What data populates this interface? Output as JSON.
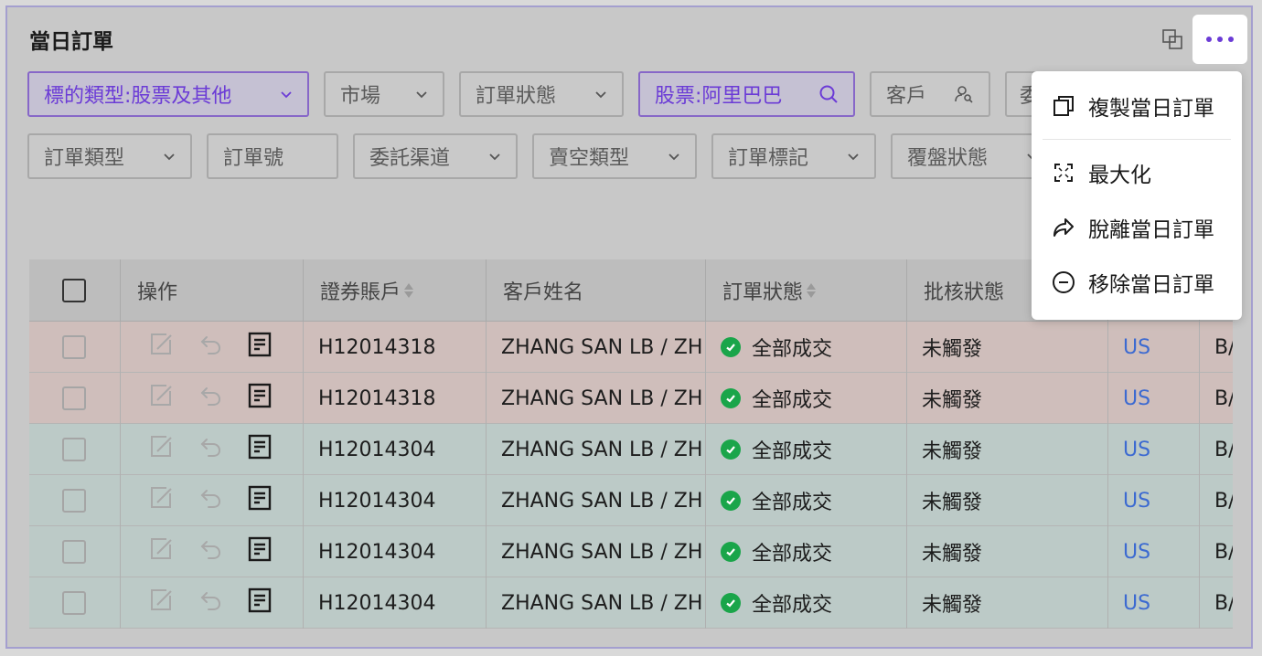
{
  "header": {
    "title": "當日訂單"
  },
  "filters": {
    "instrument_type": "標的類型:股票及其他",
    "market": "市場",
    "order_status": "訂單狀態",
    "stock": "股票:阿里巴巴",
    "client": "客戶",
    "cut": "委",
    "order_type": "訂單類型",
    "order_no": "訂單號",
    "channel": "委託渠道",
    "short_type": "賣空類型",
    "order_tag": "訂單標記",
    "cover_status": "覆盤狀態"
  },
  "table": {
    "columns": [
      "操作",
      "證券賬戶",
      "客戶姓名",
      "訂單狀態",
      "批核狀態"
    ],
    "rows": [
      {
        "account": "H12014318",
        "name": "ZHANG SAN LB / ZH",
        "status": "全部成交",
        "approval": "未觸發",
        "market": "US",
        "side": "B/",
        "kind": "sell"
      },
      {
        "account": "H12014318",
        "name": "ZHANG SAN LB / ZH",
        "status": "全部成交",
        "approval": "未觸發",
        "market": "US",
        "side": "B/",
        "kind": "sell"
      },
      {
        "account": "H12014304",
        "name": "ZHANG SAN LB / ZH",
        "status": "全部成交",
        "approval": "未觸發",
        "market": "US",
        "side": "B/",
        "kind": "buy"
      },
      {
        "account": "H12014304",
        "name": "ZHANG SAN LB / ZH",
        "status": "全部成交",
        "approval": "未觸發",
        "market": "US",
        "side": "B/",
        "kind": "buy"
      },
      {
        "account": "H12014304",
        "name": "ZHANG SAN LB / ZH",
        "status": "全部成交",
        "approval": "未觸發",
        "market": "US",
        "side": "B/",
        "kind": "buy"
      },
      {
        "account": "H12014304",
        "name": "ZHANG SAN LB / ZH",
        "status": "全部成交",
        "approval": "未觸發",
        "market": "US",
        "side": "B/",
        "kind": "buy"
      }
    ]
  },
  "menu": {
    "items": [
      {
        "label": "複製當日訂單",
        "icon": "copy-icon"
      },
      {
        "label": "最大化",
        "icon": "maximize-icon"
      },
      {
        "label": "脫離當日訂單",
        "icon": "share-arrow-icon"
      },
      {
        "label": "移除當日訂單",
        "icon": "minus-circle-icon"
      }
    ]
  },
  "colors": {
    "accent": "#6b3bd6",
    "success": "#1aa54a",
    "link": "#3c6ad1"
  }
}
